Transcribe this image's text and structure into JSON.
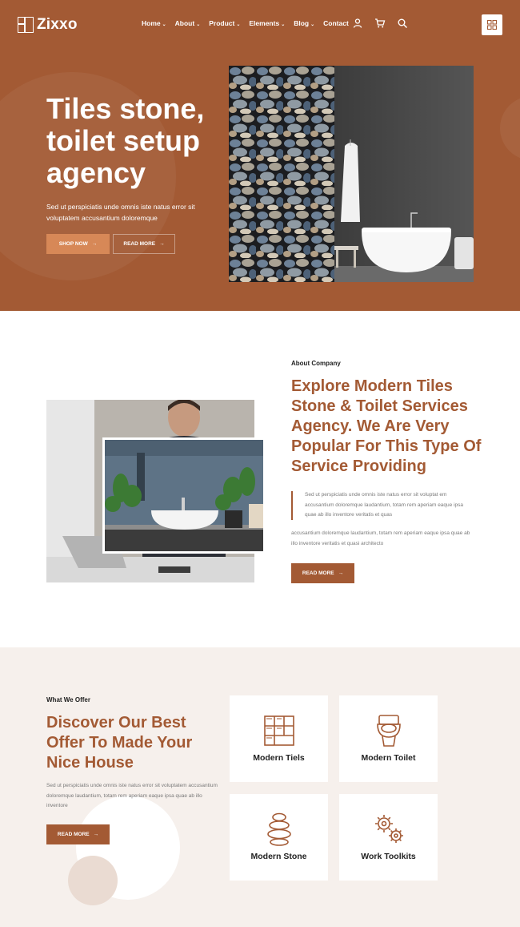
{
  "brand": {
    "name": "Zixxo"
  },
  "nav": {
    "items": [
      {
        "label": "Home",
        "dropdown": true
      },
      {
        "label": "About",
        "dropdown": true
      },
      {
        "label": "Product",
        "dropdown": true
      },
      {
        "label": "Elements",
        "dropdown": true
      },
      {
        "label": "Blog",
        "dropdown": true
      },
      {
        "label": "Contact",
        "dropdown": false
      }
    ],
    "icons": [
      "user-icon",
      "cart-icon",
      "search-icon",
      "grid-menu-icon"
    ],
    "caret": "⌄"
  },
  "hero": {
    "title": "Tiles stone, toilet setup agency",
    "text": "Sed ut perspiciatis unde omnis iste natus error sit voluptatem accusantium doloremque",
    "primary_button": "SHOP NOW",
    "secondary_button": "READ MORE",
    "arrow": "→"
  },
  "about": {
    "subtitle": "About Company",
    "title": "Explore Modern Tiles Stone & Toilet Services Agency. We Are Very Popular For This Type Of Service Providing",
    "text1": "Sed ut perspiciatis unde omnis iste natus error sit voluptat em accusantium doloremque laudantium, totam rem aperiam eaque ipsa quae ab illo inventore veritatis et quas",
    "text2": "accusantium doloremque laudantium, totam rem aperiam eaque ipsa quae ab illo inventore veritatis et quasi architecto",
    "button": "READ MORE"
  },
  "offer": {
    "subtitle": "What We Offer",
    "title": "Discover Our Best Offer To Made Your Nice House",
    "text": "Sed ut perspiciatis unde omnis iste natus error sit voluptatem accusantium doloremque laudantium, totam rem aperiam eaque ipsa quae ab illo inventore",
    "button": "READ MORE",
    "cards": [
      {
        "label": "Modern Tiels",
        "icon": "tiles-icon"
      },
      {
        "label": "Modern Toilet",
        "icon": "toilet-icon"
      },
      {
        "label": "Modern Stone",
        "icon": "stone-stack-icon"
      },
      {
        "label": "Work Toolkits",
        "icon": "gears-icon"
      }
    ]
  },
  "colors": {
    "brand": "#a35a34",
    "accent": "#d78857",
    "offer_bg": "#f6f0ec"
  }
}
